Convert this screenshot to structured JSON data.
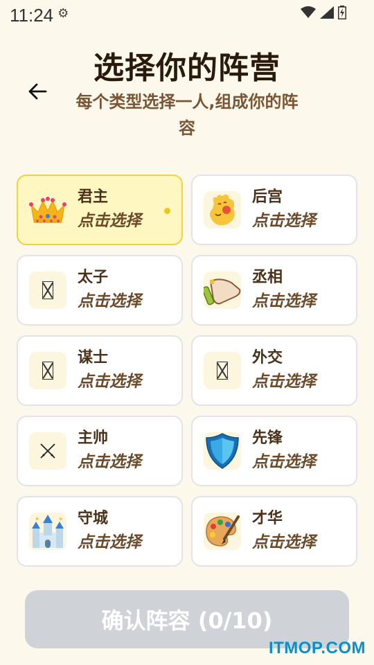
{
  "status_bar": {
    "time": "11:24"
  },
  "header": {
    "title": "选择你的阵营",
    "subtitle": "每个类型选择一人,组成你的阵容"
  },
  "roles": [
    {
      "name": "君主",
      "action": "点击选择",
      "icon": "crown-icon",
      "selected": true
    },
    {
      "name": "后宫",
      "action": "点击选择",
      "icon": "blushing-face-icon",
      "selected": false
    },
    {
      "name": "太子",
      "action": "点击选择",
      "icon": "missing-glyph-icon",
      "selected": false
    },
    {
      "name": "丞相",
      "action": "点击选择",
      "icon": "scroll-icon",
      "selected": false
    },
    {
      "name": "谋士",
      "action": "点击选择",
      "icon": "missing-glyph-icon",
      "selected": false
    },
    {
      "name": "外交",
      "action": "点击选择",
      "icon": "missing-glyph-icon",
      "selected": false
    },
    {
      "name": "主帅",
      "action": "点击选择",
      "icon": "crossed-swords-icon",
      "selected": false
    },
    {
      "name": "先锋",
      "action": "点击选择",
      "icon": "shield-icon",
      "selected": false
    },
    {
      "name": "守城",
      "action": "点击选择",
      "icon": "castle-icon",
      "selected": false
    },
    {
      "name": "才华",
      "action": "点击选择",
      "icon": "palette-icon",
      "selected": false
    }
  ],
  "confirm_button": {
    "label": "确认阵容 (0/10)"
  },
  "watermark": "ITMOP.COM",
  "colors": {
    "background": "#fdf8ec",
    "selected_card": "#fff7c2",
    "selected_border": "#f2d23a",
    "disabled_button": "#cfd3d8",
    "watermark": "#0a8fc8"
  }
}
